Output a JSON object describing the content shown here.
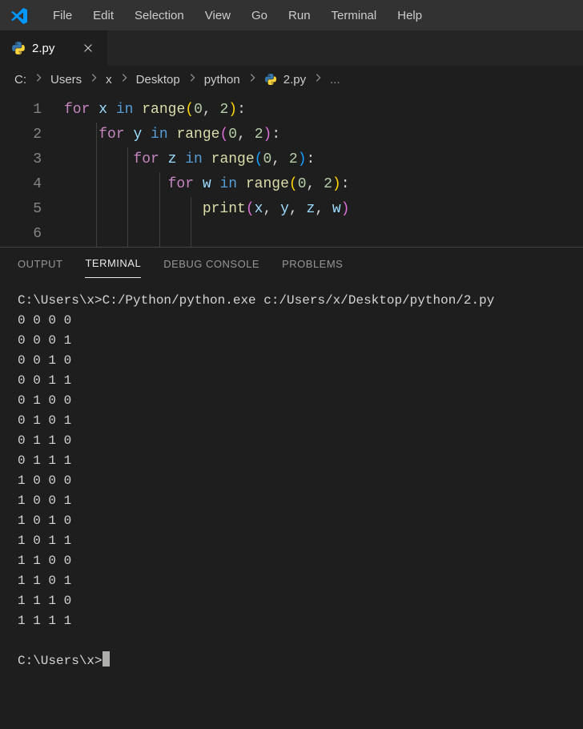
{
  "menubar": {
    "items": [
      "File",
      "Edit",
      "Selection",
      "View",
      "Go",
      "Run",
      "Terminal",
      "Help"
    ]
  },
  "tab": {
    "label": "2.py"
  },
  "breadcrumb": {
    "items": [
      "C:",
      "Users",
      "x",
      "Desktop",
      "python",
      "2.py",
      "..."
    ]
  },
  "code": {
    "lines": [
      {
        "num": "1",
        "tokens": [
          {
            "t": "for ",
            "c": "kw"
          },
          {
            "t": "x ",
            "c": "var"
          },
          {
            "t": "in ",
            "c": "op"
          },
          {
            "t": "range",
            "c": "func"
          },
          {
            "t": "(",
            "c": "paren"
          },
          {
            "t": "0",
            "c": "num"
          },
          {
            "t": ", ",
            "c": "comma"
          },
          {
            "t": "2",
            "c": "num"
          },
          {
            "t": ")",
            "c": "paren"
          },
          {
            "t": ":",
            "c": "punc"
          }
        ],
        "indent": 0
      },
      {
        "num": "2",
        "tokens": [
          {
            "t": "for ",
            "c": "kw"
          },
          {
            "t": "y ",
            "c": "var"
          },
          {
            "t": "in ",
            "c": "op"
          },
          {
            "t": "range",
            "c": "func"
          },
          {
            "t": "(",
            "c": "paren-p"
          },
          {
            "t": "0",
            "c": "num"
          },
          {
            "t": ", ",
            "c": "comma"
          },
          {
            "t": "2",
            "c": "num"
          },
          {
            "t": ")",
            "c": "paren-p"
          },
          {
            "t": ":",
            "c": "punc"
          }
        ],
        "indent": 1
      },
      {
        "num": "3",
        "tokens": [
          {
            "t": "for ",
            "c": "kw"
          },
          {
            "t": "z ",
            "c": "var"
          },
          {
            "t": "in ",
            "c": "op"
          },
          {
            "t": "range",
            "c": "func"
          },
          {
            "t": "(",
            "c": "paren-b"
          },
          {
            "t": "0",
            "c": "num"
          },
          {
            "t": ", ",
            "c": "comma"
          },
          {
            "t": "2",
            "c": "num"
          },
          {
            "t": ")",
            "c": "paren-b"
          },
          {
            "t": ":",
            "c": "punc"
          }
        ],
        "indent": 2
      },
      {
        "num": "4",
        "tokens": [
          {
            "t": "for ",
            "c": "kw"
          },
          {
            "t": "w ",
            "c": "var"
          },
          {
            "t": "in ",
            "c": "op"
          },
          {
            "t": "range",
            "c": "func"
          },
          {
            "t": "(",
            "c": "paren"
          },
          {
            "t": "0",
            "c": "num"
          },
          {
            "t": ", ",
            "c": "comma"
          },
          {
            "t": "2",
            "c": "num"
          },
          {
            "t": ")",
            "c": "paren"
          },
          {
            "t": ":",
            "c": "punc"
          }
        ],
        "indent": 3
      },
      {
        "num": "5",
        "tokens": [
          {
            "t": "print",
            "c": "func"
          },
          {
            "t": "(",
            "c": "paren-p"
          },
          {
            "t": "x",
            "c": "var"
          },
          {
            "t": ", ",
            "c": "comma"
          },
          {
            "t": "y",
            "c": "var"
          },
          {
            "t": ", ",
            "c": "comma"
          },
          {
            "t": "z",
            "c": "var"
          },
          {
            "t": ", ",
            "c": "comma"
          },
          {
            "t": "w",
            "c": "var"
          },
          {
            "t": ")",
            "c": "paren-p"
          }
        ],
        "indent": 4
      },
      {
        "num": "6",
        "tokens": [],
        "indent": 0
      }
    ]
  },
  "panel": {
    "tabs": [
      "OUTPUT",
      "TERMINAL",
      "DEBUG CONSOLE",
      "PROBLEMS"
    ],
    "active": 1
  },
  "terminal": {
    "cmd_line": "C:\\Users\\x>C:/Python/python.exe c:/Users/x/Desktop/python/2.py",
    "output": [
      "0 0 0 0",
      "0 0 0 1",
      "0 0 1 0",
      "0 0 1 1",
      "0 1 0 0",
      "0 1 0 1",
      "0 1 1 0",
      "0 1 1 1",
      "1 0 0 0",
      "1 0 0 1",
      "1 0 1 0",
      "1 0 1 1",
      "1 1 0 0",
      "1 1 0 1",
      "1 1 1 0",
      "1 1 1 1"
    ],
    "prompt": "C:\\Users\\x>"
  }
}
